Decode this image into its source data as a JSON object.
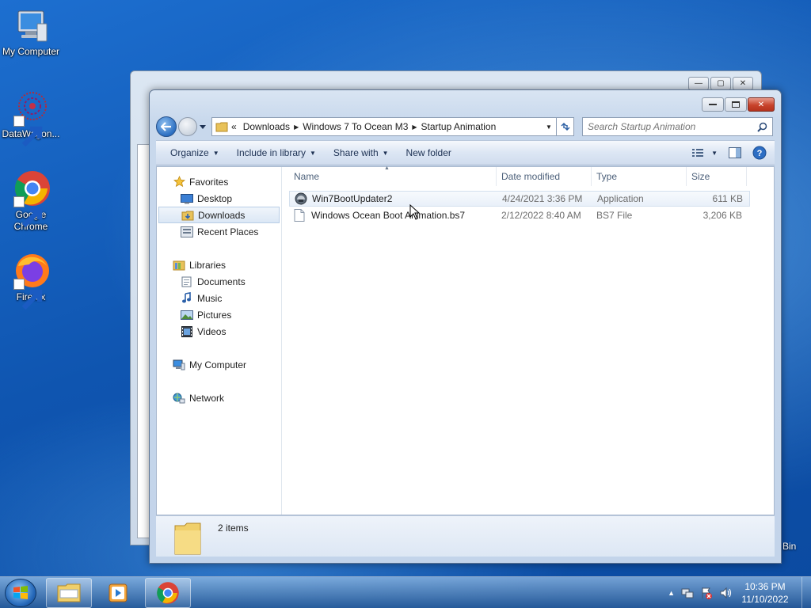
{
  "desktop": {
    "icons": [
      {
        "label": "My Computer"
      },
      {
        "label": "DataWagon..."
      },
      {
        "label": "Google Chrome"
      },
      {
        "label": "Firefox"
      }
    ],
    "recycle_bin_partial": "Bin"
  },
  "window": {
    "address": {
      "overflow": "«",
      "crumbs": [
        "Downloads",
        "Windows 7 To Ocean M3",
        "Startup Animation"
      ]
    },
    "search": {
      "placeholder": "Search Startup Animation"
    },
    "toolbar": {
      "organize": "Organize",
      "include_in_library": "Include in library",
      "share_with": "Share with",
      "new_folder": "New folder"
    },
    "nav": {
      "favorites": "Favorites",
      "desktop": "Desktop",
      "downloads": "Downloads",
      "recent_places": "Recent Places",
      "libraries": "Libraries",
      "documents": "Documents",
      "music": "Music",
      "pictures": "Pictures",
      "videos": "Videos",
      "my_computer": "My Computer",
      "network": "Network"
    },
    "columns": {
      "name": "Name",
      "date": "Date modified",
      "type": "Type",
      "size": "Size"
    },
    "files": [
      {
        "name": "Win7BootUpdater2",
        "date": "4/24/2021 3:36 PM",
        "type": "Application",
        "size": "611 KB"
      },
      {
        "name": "Windows Ocean Boot Animation.bs7",
        "date": "2/12/2022 8:40 AM",
        "type": "BS7 File",
        "size": "3,206 KB"
      }
    ],
    "status": {
      "count": "2 items"
    }
  },
  "taskbar": {
    "clock": {
      "time": "10:36 PM",
      "date": "11/10/2022"
    }
  },
  "colors": {
    "accent": "#1e3254",
    "selection": "#dbe7f5",
    "close": "#c8432c"
  }
}
